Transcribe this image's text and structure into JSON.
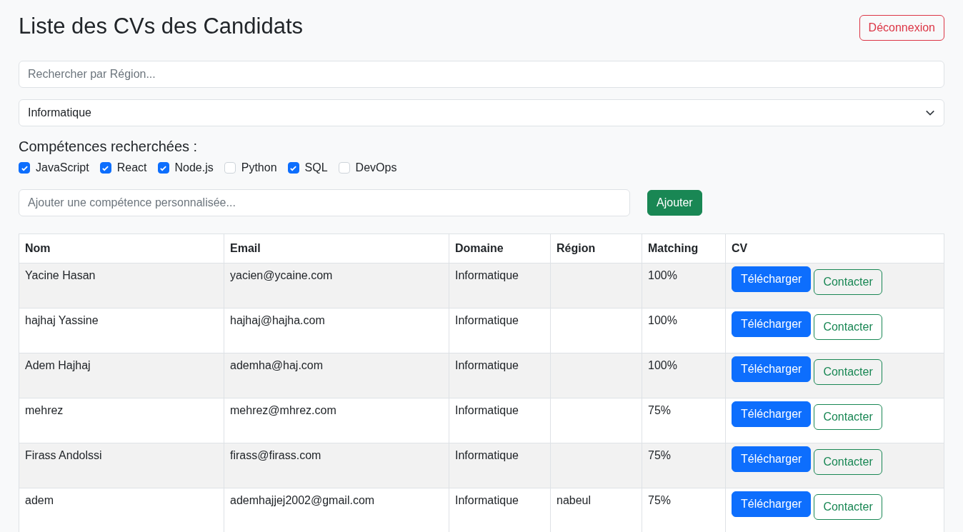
{
  "title": "Liste des CVs des Candidats",
  "logout_button": "Déconnexion",
  "region_search": {
    "placeholder": "Rechercher par Région..."
  },
  "domain_select": {
    "value": "Informatique"
  },
  "skills_label": "Compétences recherchées :",
  "skills": [
    {
      "label": "JavaScript",
      "checked": true
    },
    {
      "label": "React",
      "checked": true
    },
    {
      "label": "Node.js",
      "checked": true
    },
    {
      "label": "Python",
      "checked": false
    },
    {
      "label": "SQL",
      "checked": true
    },
    {
      "label": "DevOps",
      "checked": false
    }
  ],
  "custom_skill": {
    "placeholder": "Ajouter une compétence personnalisée..."
  },
  "add_button": "Ajouter",
  "table": {
    "columns": [
      "Nom",
      "Email",
      "Domaine",
      "Région",
      "Matching",
      "CV"
    ],
    "rows": [
      {
        "name": "Yacine Hasan",
        "email": "yacien@ycaine.com",
        "domain": "Informatique",
        "region": "",
        "matching": "100%",
        "download": "Télécharger",
        "contact": "Contacter"
      },
      {
        "name": "hajhaj Yassine",
        "email": "hajhaj@hajha.com",
        "domain": "Informatique",
        "region": "",
        "matching": "100%",
        "download": "Télécharger",
        "contact": "Contacter"
      },
      {
        "name": "Adem Hajhaj",
        "email": "ademha@haj.com",
        "domain": "Informatique",
        "region": "",
        "matching": "100%",
        "download": "Télécharger",
        "contact": "Contacter"
      },
      {
        "name": "mehrez",
        "email": "mehrez@mhrez.com",
        "domain": "Informatique",
        "region": "",
        "matching": "75%",
        "download": "Télécharger",
        "contact": "Contacter"
      },
      {
        "name": "Firass Andolssi",
        "email": "firass@firass.com",
        "domain": "Informatique",
        "region": "",
        "matching": "75%",
        "download": "Télécharger",
        "contact": "Contacter"
      },
      {
        "name": "adem",
        "email": "ademhajjej2002@gmail.com",
        "domain": "Informatique",
        "region": "nabeul",
        "matching": "75%",
        "download": "Télécharger",
        "contact": "Contacter"
      }
    ]
  }
}
